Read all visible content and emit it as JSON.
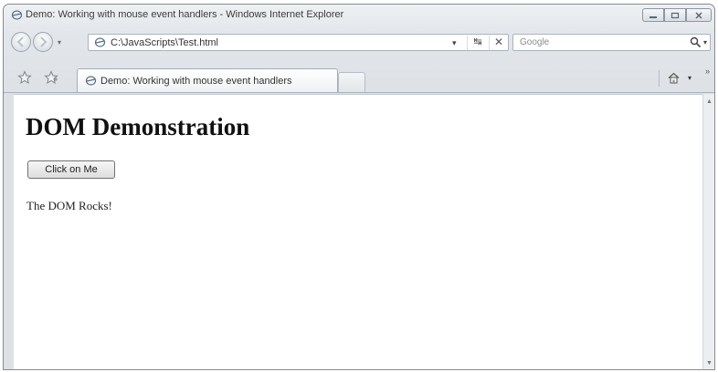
{
  "window": {
    "title": "Demo: Working with mouse event handlers - Windows Internet Explorer",
    "controls": {
      "minimize": "minimize-icon",
      "maximize": "maximize-icon",
      "close": "close-icon"
    }
  },
  "address_bar": {
    "url": "C:\\JavaScripts\\Test.html"
  },
  "search": {
    "placeholder": "Google"
  },
  "tabs": [
    {
      "label": "Demo: Working with mouse event handlers"
    }
  ],
  "page": {
    "heading": "DOM Demonstration",
    "button_label": "Click on Me",
    "body_text": "The DOM Rocks!"
  },
  "icons": [
    "ie-page-icon",
    "back-icon",
    "forward-icon",
    "refresh-icon",
    "stop-icon",
    "search-icon",
    "favorites-star-icon",
    "add-favorite-icon",
    "home-icon"
  ]
}
